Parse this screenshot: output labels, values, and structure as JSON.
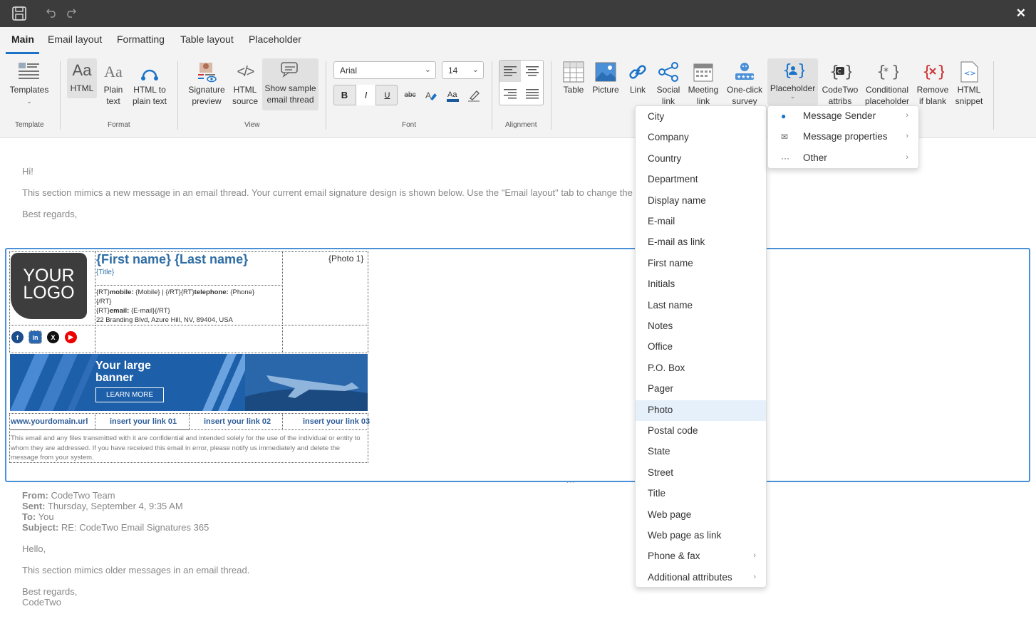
{
  "tabs": [
    "Main",
    "Email layout",
    "Formatting",
    "Table layout",
    "Placeholder"
  ],
  "ribbon": {
    "templates": "Templates",
    "template_group": "Template",
    "html": "HTML",
    "plain_text": [
      "Plain",
      "text"
    ],
    "html_to_plain": [
      "HTML to",
      "plain text"
    ],
    "format_group": "Format",
    "sig_preview": [
      "Signature",
      "preview"
    ],
    "html_source": [
      "HTML",
      "source"
    ],
    "sample_thread": [
      "Show sample",
      "email thread"
    ],
    "view_group": "View",
    "font_name": "Arial",
    "font_size": "14",
    "font_group": "Font",
    "alignment_group": "Alignment",
    "table": "Table",
    "picture": "Picture",
    "link": "Link",
    "social": [
      "Social",
      "link"
    ],
    "meeting": [
      "Meeting",
      "link"
    ],
    "survey": [
      "One-click",
      "survey"
    ],
    "placeholder": "Placeholder",
    "codetwo": [
      "CodeTwo",
      "attribs"
    ],
    "conditional": [
      "Conditional",
      "placeholder"
    ],
    "remove_blank": [
      "Remove",
      "if blank"
    ],
    "snippet": [
      "HTML",
      "snippet"
    ]
  },
  "email_top": {
    "greeting": "Hi!",
    "body": "This section mimics a new message in an email thread. Your current email signature design is shown below. Use the \"Email layout\" tab to change the position of the signature.",
    "closing": "Best regards,"
  },
  "signature": {
    "logo_line1": "YOUR",
    "logo_line2": "LOGO",
    "name": "{First name} {Last name}",
    "title": "{Title}",
    "photo": "{Photo 1}",
    "contact_line1_a": "{RT}",
    "contact_mobile_label": "mobile:",
    "contact_mobile": " {Mobile}  |  {/RT}{RT}",
    "contact_tel_label": "telephone:",
    "contact_tel": " {Phone}",
    "contact_line2": "{/RT}",
    "contact_line3_a": "{RT}",
    "contact_email_label": "email:",
    "contact_email": " {E-mail}{/RT}",
    "address": "22 Branding Blvd, Azure Hill, NV, 89404, USA",
    "banner_title1": "Your large",
    "banner_title2": "banner",
    "banner_button": "LEARN MORE",
    "links": [
      "www.yourdomain.url",
      "insert your link 01",
      "insert your link 02",
      "insert your link 03"
    ],
    "disclaimer": "This email and any files transmitted with it are confidential and intended solely for the use of the individual or entity to whom they are addressed. If you have received this email in error, please notify us immediately and delete the message from your system."
  },
  "email_bottom": {
    "from_label": "From:",
    "from": " CodeTwo Team",
    "sent_label": "Sent:",
    "sent": " Thursday, September 4, 9:35 AM",
    "to_label": "To:",
    "to": " You",
    "subject_label": "Subject:",
    "subject": " RE: CodeTwo Email Signatures 365",
    "hello": "Hello,",
    "body": "This section mimics older messages in an email thread.",
    "regards": "Best regards,",
    "sign": "CodeTwo"
  },
  "placeholder_menu": {
    "items": [
      "City",
      "Company",
      "Country",
      "Department",
      "Display name",
      "E-mail",
      "E-mail as link",
      "First name",
      "Initials",
      "Last name",
      "Notes",
      "Office",
      "P.O. Box",
      "Pager",
      "Photo",
      "Postal code",
      "State",
      "Street",
      "Title",
      "Web page",
      "Web page as link",
      "Phone & fax",
      "Additional attributes"
    ],
    "highlighted": "Photo"
  },
  "submenu": {
    "items": [
      "Message Sender",
      "Message properties",
      "Other"
    ]
  },
  "colors": {
    "accent": "#1a73c9",
    "name_blue": "#2e6da4",
    "banner": "#1d5fa8"
  }
}
